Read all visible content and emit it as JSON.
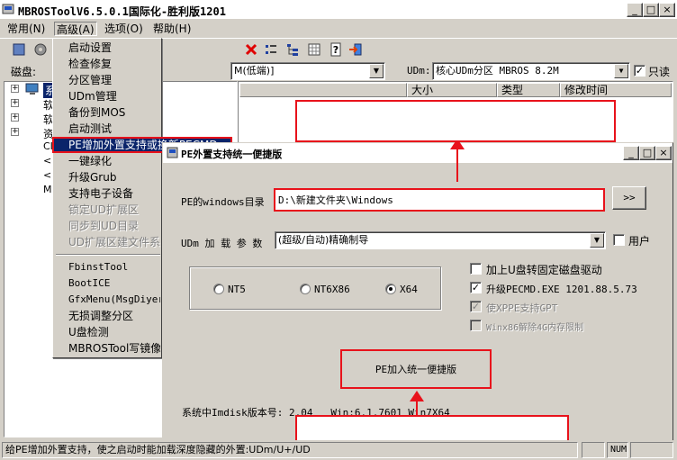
{
  "window": {
    "title": "MBROSToolV6.5.0.1国际化-胜利版1201",
    "min": "_",
    "max": "□",
    "close": "×"
  },
  "menubar": {
    "items": [
      "常用(N)",
      "高级(A)",
      "选项(O)",
      "帮助(H)"
    ]
  },
  "row2": {
    "disk_label": "磁盘:",
    "disk_value": "M(低端)]",
    "udm_label": "UDm:",
    "udm_value": "核心UDm分区 MBROS 8.2M",
    "readonly_label": "只读",
    "readonly_checked": true
  },
  "list": {
    "columns": [
      "大小",
      "类型",
      "修改时间"
    ]
  },
  "tree": {
    "items": [
      "系",
      "软",
      "软",
      "资",
      "CI",
      "<",
      "<",
      "ME"
    ]
  },
  "dropdown": {
    "items": [
      {
        "label": "启动设置",
        "disabled": false
      },
      {
        "label": "检查修复",
        "disabled": false
      },
      {
        "label": "分区管理",
        "disabled": false
      },
      {
        "label": "UDm管理",
        "disabled": false
      },
      {
        "label": "备份到MOS",
        "disabled": false
      },
      {
        "label": "启动测试",
        "disabled": false
      },
      {
        "label": "PE增加外置支持或换新PECMD",
        "disabled": false,
        "selected": true
      },
      {
        "label": "一键绿化",
        "disabled": false
      },
      {
        "label": "升级Grub",
        "disabled": false
      },
      {
        "label": "支持电子设备",
        "disabled": false
      },
      {
        "label": "锁定UD扩展区",
        "disabled": true
      },
      {
        "label": "同步到UD目录",
        "disabled": true
      },
      {
        "label": "UD扩展区建文件系统",
        "disabled": true
      },
      {
        "label": "FbinstTool",
        "disabled": false
      },
      {
        "label": "BootICE",
        "disabled": false
      },
      {
        "label": "GfxMenu(MsgDiyer)",
        "disabled": false
      },
      {
        "label": "无损调整分区",
        "disabled": false
      },
      {
        "label": "U盘检测",
        "disabled": false
      },
      {
        "label": "MBROSTool写镜像",
        "disabled": false
      }
    ]
  },
  "dialog": {
    "title": "PE外置支持统一便捷版",
    "windows_dir_label": "PE的windows目录",
    "windows_dir_value": "D:\\新建文件夹\\Windows",
    "browse_label": ">>",
    "udm_params_label": "UDm 加 载 参 数",
    "udm_params_value": "(超级/自动)精确制导",
    "user_label": "用户",
    "radios": [
      {
        "label": "NT5",
        "selected": false
      },
      {
        "label": "NT6X86",
        "selected": false
      },
      {
        "label": "X64",
        "selected": true
      }
    ],
    "options": [
      {
        "label": "加上U盘转固定磁盘驱动",
        "checked": false,
        "disabled": false
      },
      {
        "label": "升级PECMD.EXE 1201.88.5.73",
        "checked": true,
        "disabled": false
      },
      {
        "label": "使XPPE支持GPT",
        "checked": true,
        "disabled": true
      },
      {
        "label": "Winx86解除4G内存限制",
        "checked": false,
        "disabled": true
      }
    ],
    "action_label": "PE加入统一便捷版",
    "imdisk_info": "系统中Imdisk版本号: 2.04   Win:6.1.7601 Win7X64"
  },
  "status": {
    "message": "给PE增加外置支持，使之启动时能加载深度隐藏的外置:UDm/U+/UD",
    "num": "NUM"
  },
  "colors": {
    "accent_red": "#e8121b",
    "menu_highlight": "#0a246a",
    "chrome": "#d4d0c8"
  }
}
